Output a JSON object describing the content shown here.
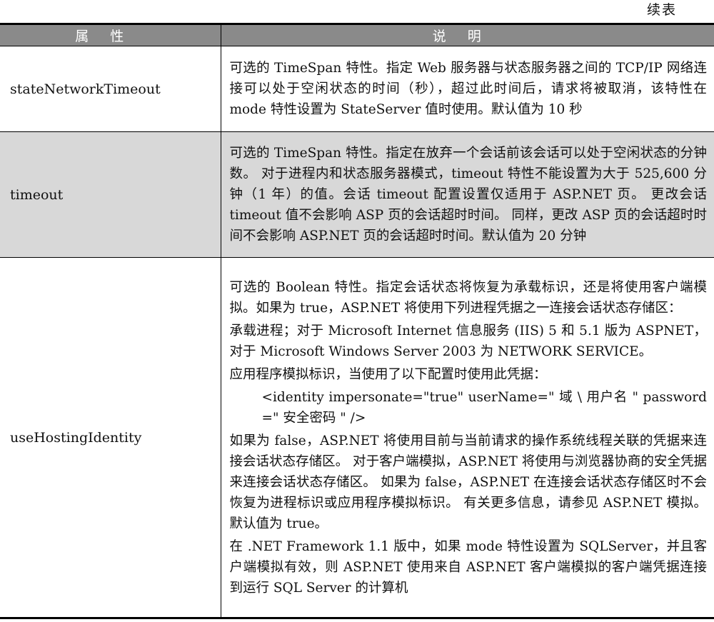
{
  "continued_label": "续表",
  "header": {
    "col_attribute": "属性",
    "col_description": "说明"
  },
  "rows": [
    {
      "attribute": "stateNetworkTimeout",
      "paragraphs": [
        "可选的 TimeSpan 特性。指定 Web 服务器与状态服务器之间的 TCP/IP 网络连接可以处于空闲状态的时间（秒），超过此时间后，请求将被取消，该特性在 mode 特性设置为 StateServer 值时使用。默认值为 10 秒"
      ]
    },
    {
      "attribute": "timeout",
      "paragraphs": [
        "可选的 TimeSpan 特性。指定在放弃一个会话前该会话可以处于空闲状态的分钟数。 对于进程内和状态服务器模式，timeout 特性不能设置为大于 525,600 分钟（1 年）的值。会话 timeout 配置设置仅适用于 ASP.NET 页。 更改会话 timeout 值不会影响 ASP 页的会话超时时间。 同样，更改 ASP 页的会话超时时间不会影响 ASP.NET 页的会话超时时间。默认值为 20 分钟"
      ]
    },
    {
      "attribute": "useHostingIdentity",
      "paragraphs": [
        "可选的 Boolean 特性。指定会话状态将恢复为承载标识，还是将使用客户端模拟。如果为 true，ASP.NET 将使用下列进程凭据之一连接会话状态存储区：",
        "承载进程；对于 Microsoft Internet 信息服务 (IIS) 5 和 5.1 版为 ASPNET，对于 Microsoft Windows Server 2003 为 NETWORK SERVICE。",
        "应用程序模拟标识，当使用了以下配置时使用此凭据：",
        "<identity impersonate=\"true\" userName=\" 域 \\ 用户名 \" password =\" 安全密码 \" />",
        "如果为 false，ASP.NET 将使用目前与当前请求的操作系统线程关联的凭据来连接会话状态存储区。 对于客户端模拟，ASP.NET 将使用与浏览器协商的安全凭据来连接会话状态存储区。 如果为 false，ASP.NET 在连接会话状态存储区时不会恢复为进程标识或应用程序模拟标识。 有关更多信息，请参见 ASP.NET 模拟。默认值为 true。",
        "在 .NET Framework 1.1 版中，如果 mode 特性设置为 SQLServer，并且客户端模拟有效，则 ASP.NET 使用来自 ASP.NET 客户端模拟的客户端凭据连接到运行 SQL Server 的计算机"
      ]
    }
  ]
}
